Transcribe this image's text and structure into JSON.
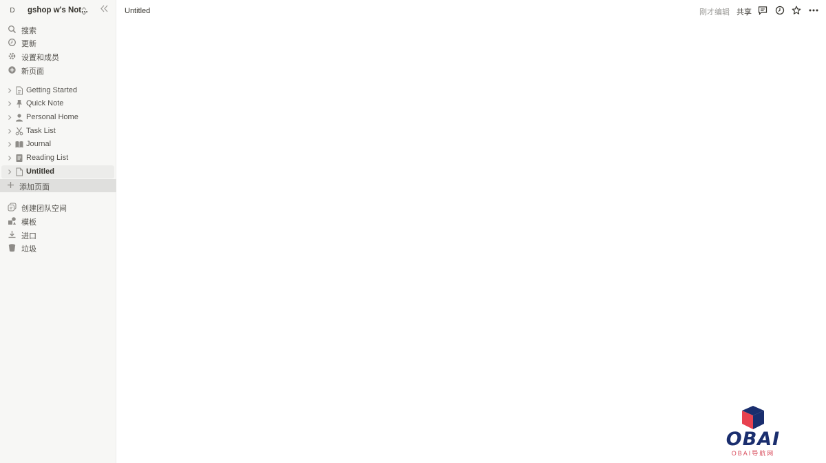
{
  "workspace": {
    "avatar_letter": "D",
    "name": "gshop w's Not..."
  },
  "sidebar": {
    "top_items": [
      {
        "label": "搜索",
        "icon": "search-icon"
      },
      {
        "label": "更新",
        "icon": "clock-icon"
      },
      {
        "label": "设置和成员",
        "icon": "gear-icon"
      },
      {
        "label": "新页面",
        "icon": "plus-circle-icon"
      }
    ],
    "pages": [
      {
        "label": "Getting Started",
        "icon": "page-icon"
      },
      {
        "label": "Quick Note",
        "icon": "pin-icon"
      },
      {
        "label": "Personal Home",
        "icon": "person-icon"
      },
      {
        "label": "Task List",
        "icon": "scissors-icon"
      },
      {
        "label": "Journal",
        "icon": "book-icon"
      },
      {
        "label": "Reading List",
        "icon": "notebook-icon"
      },
      {
        "label": "Untitled",
        "icon": "page-icon",
        "active": true
      }
    ],
    "add_page_label": "添加页面",
    "bottom_items": [
      {
        "label": "创建团队空间",
        "icon": "team-space-icon"
      },
      {
        "label": "模板",
        "icon": "shapes-icon"
      },
      {
        "label": "进口",
        "icon": "download-icon"
      },
      {
        "label": "垃圾",
        "icon": "trash-icon"
      }
    ]
  },
  "topbar": {
    "breadcrumb": "Untitled",
    "edited_status": "刚才编辑",
    "share_label": "共享"
  },
  "watermark": {
    "logo_text": "OBAI",
    "sub_text": "OBAI导航网"
  }
}
